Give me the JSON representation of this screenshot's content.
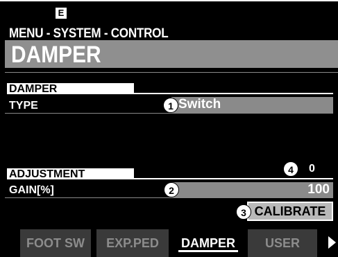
{
  "header": {
    "edit_indicator": "E",
    "breadcrumb": "MENU - SYSTEM - CONTROL",
    "page_title": "DAMPER"
  },
  "damper_section": {
    "heading": "DAMPER",
    "type_label": "TYPE",
    "type_value": "Switch",
    "callout": "1"
  },
  "adjustment_section": {
    "heading": "ADJUSTMENT",
    "readout_callout": "4",
    "readout_value": "0",
    "gain_label": "GAIN[%]",
    "gain_callout": "2",
    "gain_value": "100",
    "calibrate_callout": "3",
    "calibrate_label": "CALIBRATE"
  },
  "tabs": [
    {
      "label": "FOOT SW",
      "active": false
    },
    {
      "label": "EXP.PED",
      "active": false
    },
    {
      "label": "DAMPER",
      "active": true
    },
    {
      "label": "USER",
      "active": false
    }
  ],
  "icons": {
    "next_page": "right-triangle-arrow-icon"
  },
  "colors": {
    "background": "#000000",
    "foreground": "#ffffff",
    "highlight_bar": "#8f8f8f",
    "value_box": "#8a8a8a",
    "inactive_tab": "#3a3a3a",
    "button": "#b9b9b9"
  }
}
